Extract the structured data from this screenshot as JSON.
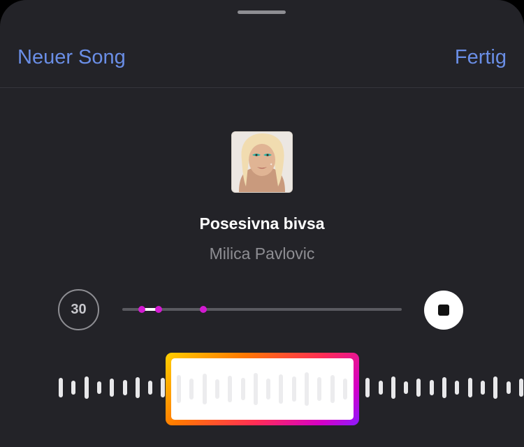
{
  "nav": {
    "left_label": "Neuer Song",
    "right_label": "Fertig"
  },
  "song": {
    "title": "Posesivna bivsa",
    "artist": "Milica Pavlovic"
  },
  "player": {
    "duration_label": "30",
    "progress_fraction": 0.13,
    "selection_start_fraction": 0.07,
    "selection_end_fraction": 0.29
  },
  "colors": {
    "accent": "#6a8ee6",
    "background": "#232328",
    "marker": "#d21ad1",
    "gradient": [
      "#ffd000",
      "#ff7a00",
      "#ff2d55",
      "#d400c8",
      "#8b1cff"
    ]
  },
  "icons": {
    "stop": "stop-icon",
    "grabber": "grabber-handle"
  }
}
